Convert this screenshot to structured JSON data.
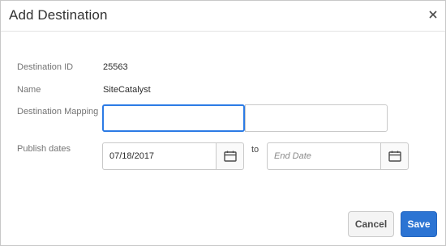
{
  "dialog": {
    "title": "Add Destination",
    "close_icon": "close-icon"
  },
  "fields": {
    "destination_id_label": "Destination ID",
    "destination_id_value": "25563",
    "name_label": "Name",
    "name_value": "SiteCatalyst",
    "mapping_label": "Destination Mapping",
    "mapping_value": "",
    "publish_dates_label": "Publish dates",
    "start_date_value": "07/18/2017",
    "to_label": "to",
    "end_date_placeholder": "End Date",
    "calendar_icon": "calendar-icon"
  },
  "footer": {
    "cancel_label": "Cancel",
    "save_label": "Save"
  },
  "colors": {
    "accent": "#2c74d3",
    "focus_border": "#2c7be5"
  }
}
